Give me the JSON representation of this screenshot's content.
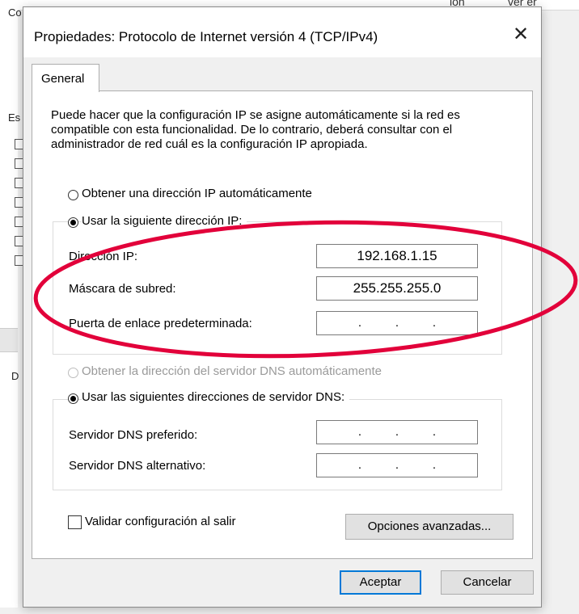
{
  "background": {
    "top_text_1": "ion",
    "top_text_2": "ver er",
    "left_text_1": "Co",
    "left_text_2": "Es",
    "left_text_3": "D"
  },
  "dialog": {
    "title": "Propiedades: Protocolo de Internet versión 4 (TCP/IPv4)",
    "close_glyph": "✕",
    "tab_general": "General",
    "description": "Puede hacer que la configuración IP se asigne automáticamente si la red es compatible con esta funcionalidad. De lo contrario, deberá consultar con el administrador de red cuál es la configuración IP apropiada.",
    "ip_auto_label": "Obtener una dirección IP automáticamente",
    "ip_manual_label": "Usar la siguiente dirección IP:",
    "ip_address_label": "Dirección IP:",
    "ip_address_value": "192.168.1.15",
    "subnet_label": "Máscara de subred:",
    "subnet_value": "255.255.255.0",
    "gateway_label": "Puerta de enlace predeterminada:",
    "gateway_dots": [
      ".",
      ".",
      "."
    ],
    "dns_auto_label": "Obtener la dirección del servidor DNS automáticamente",
    "dns_manual_label": "Usar las siguientes direcciones de servidor DNS:",
    "dns_pref_label": "Servidor DNS preferido:",
    "dns_pref_dots": [
      ".",
      ".",
      "."
    ],
    "dns_alt_label": "Servidor DNS alternativo:",
    "dns_alt_dots": [
      ".",
      ".",
      "."
    ],
    "validate_label": "Validar configuración al salir",
    "advanced_button": "Opciones avanzadas...",
    "ok_button": "Aceptar",
    "cancel_button": "Cancelar"
  },
  "state": {
    "ip_mode": "manual",
    "dns_mode": "manual",
    "validate_checked": false
  },
  "colors": {
    "annotation_ellipse": "#e2003a",
    "default_button_border": "#0078d7"
  }
}
